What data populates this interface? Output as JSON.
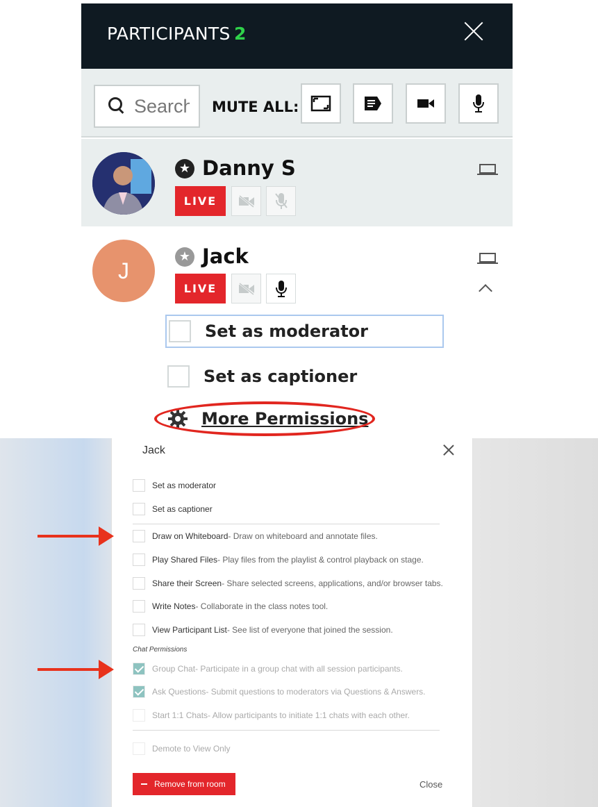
{
  "header": {
    "title": "PARTICIPANTS",
    "count": "2"
  },
  "toolbar": {
    "search_placeholder": "Search",
    "mute_all_label": "MUTE ALL:",
    "buttons": [
      "screen-share-icon",
      "notes-icon",
      "camera-icon",
      "microphone-icon"
    ]
  },
  "participants": [
    {
      "name": "Danny S",
      "live_label": "LIVE",
      "role_icon": "star-icon",
      "video_muted": true,
      "mic_muted": true
    },
    {
      "name": "Jack",
      "initial": "J",
      "live_label": "LIVE",
      "role_icon": "star-icon",
      "video_muted": true,
      "mic_muted": false,
      "avatar_color": "#e7936d"
    }
  ],
  "expanded": {
    "options": [
      "Set as moderator",
      "Set as captioner"
    ],
    "more_permissions": "More Permissions"
  },
  "modal": {
    "title": "Jack",
    "role_options": [
      {
        "label": "Set as moderator",
        "checked": false
      },
      {
        "label": "Set as captioner",
        "checked": false
      }
    ],
    "permissions": [
      {
        "label": "Draw on Whiteboard",
        "desc": " - Draw on whiteboard and annotate files.",
        "checked": false
      },
      {
        "label": "Play Shared Files",
        "desc": " - Play files from the playlist & control playback on stage.",
        "checked": false
      },
      {
        "label": "Share their Screen",
        "desc": " - Share selected screens, applications, and/or browser tabs.",
        "checked": false
      },
      {
        "label": "Write Notes",
        "desc": " - Collaborate in the class notes tool.",
        "checked": false
      },
      {
        "label": "View Participant List",
        "desc": " - See list of everyone that joined the session.",
        "checked": false
      }
    ],
    "chat_section_label": "Chat Permissions",
    "chat_permissions": [
      {
        "label": "Group Chat",
        "desc": " - Participate in a group chat with all session participants.",
        "checked": true
      },
      {
        "label": "Ask Questions",
        "desc": " - Submit questions to moderators via Questions & Answers.",
        "checked": true
      },
      {
        "label": "Start 1:1 Chats",
        "desc": " - Allow participants to initiate 1:1 chats with each other.",
        "checked": false
      }
    ],
    "demote_label": "Demote to View Only",
    "remove_label": "Remove from room",
    "close_label": "Close"
  },
  "colors": {
    "header_bg": "#0f1a22",
    "count_green": "#2fd14a",
    "live_red": "#e3262b",
    "annotation_red": "#e8321c",
    "check_teal": "#8ec3c0"
  }
}
